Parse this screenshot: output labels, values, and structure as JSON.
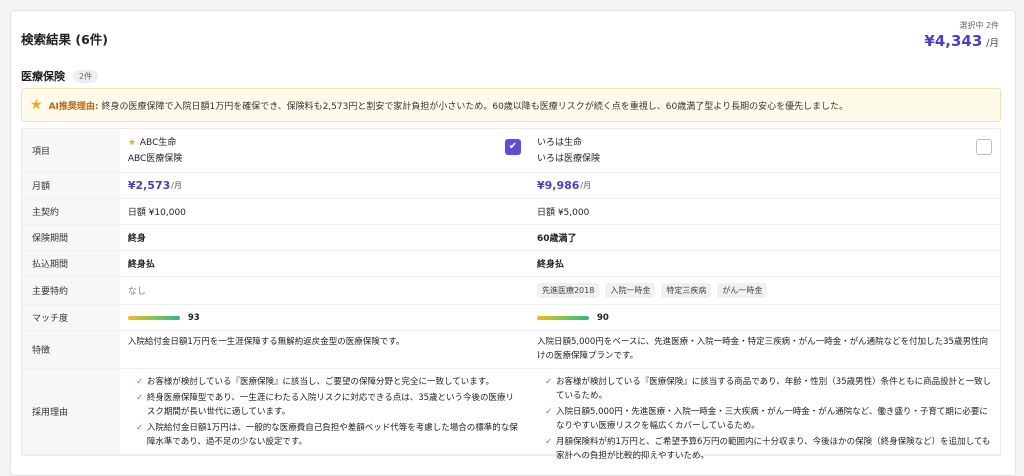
{
  "header": {
    "title": "検索結果 (6件)",
    "selected_label": "選択中 2件",
    "selected_amount": "¥4,343",
    "selected_unit": "/月"
  },
  "category": {
    "title": "医療保険",
    "count": "2件"
  },
  "ai": {
    "label": "AI推奨理由:",
    "text": "終身の医療保障で入院日額1万円を確保でき、保険料も2,573円と割安で家計負担が小さいため。60歳以降も医療リスクが続く点を重視し、60歳満了型より長期の安心を優先しました。"
  },
  "rows": {
    "item": "項目",
    "monthly": "月額",
    "main": "主契約",
    "period": "保険期間",
    "payment": "払込期間",
    "riders": "主要特約",
    "match": "マッチ度",
    "features": "特徴",
    "reasons": "採用理由"
  },
  "products": [
    {
      "company": "ABC生命",
      "name": "ABC医療保険",
      "price": "¥2,573",
      "price_unit": "/月",
      "main": "日額 ¥10,000",
      "period": "終身",
      "payment": "終身払",
      "riders_none": "なし",
      "score": "93",
      "feature": "入院給付金日額1万円を一生涯保障する無解約返戻金型の医療保険です。",
      "reasons": [
        "お客様が検討している『医療保険』に該当し、ご要望の保障分野と完全に一致しています。",
        "終身医療保障型であり、一生涯にわたる入院リスクに対応できる点は、35歳という今後の医療リスク期間が長い世代に適しています。",
        "入院給付金日額1万円は、一般的な医療費自己負担や差額ベッド代等を考慮した場合の標準的な保障水準であり、過不足の少ない設定です。"
      ],
      "selected": true
    },
    {
      "company": "いろは生命",
      "name": "いろは医療保険",
      "price": "¥9,986",
      "price_unit": "/月",
      "main": "日額 ¥5,000",
      "period": "60歳満了",
      "payment": "終身払",
      "riders": [
        "先進医療2018",
        "入院一時金",
        "特定三疾病",
        "がん一時金"
      ],
      "score": "90",
      "feature": "入院日額5,000円をベースに、先進医療・入院一時金・特定三疾病・がん一時金・がん通院などを付加した35歳男性向けの医療保障プランです。",
      "reasons": [
        "お客様が検討している『医療保険』に該当する商品であり、年齢・性別（35歳男性）条件ともに商品設計と一致しているため。",
        "入院日額5,000円・先進医療・入院一時金・三大疾病・がん一時金・がん通院など、働き盛り・子育て期に必要になりやすい医療リスクを幅広くカバーしているため。",
        "月額保険料が約1万円と、ご希望予算6万円の範囲内に十分収まり、今後ほかの保険（終身保険など）を追加しても家計への負担が比較的抑えやすいため。"
      ],
      "selected": false
    }
  ],
  "colors": {
    "accent": "#4b3fc8",
    "star": "#f0a81e",
    "check": "#3aa35a"
  }
}
